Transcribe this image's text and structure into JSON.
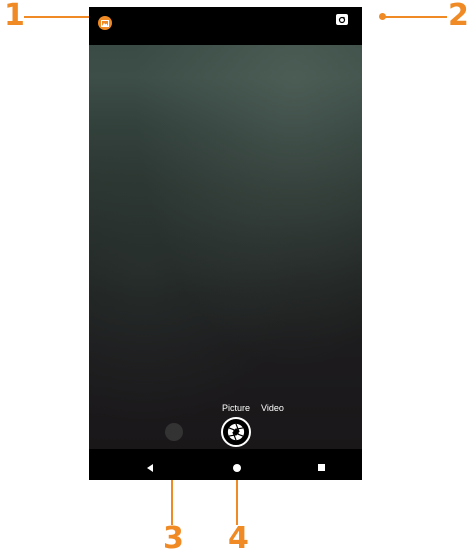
{
  "callouts": {
    "c1": "1",
    "c2": "2",
    "c3": "3",
    "c4": "4",
    "color": "#F08A24"
  },
  "camera": {
    "modes": {
      "picture": "Picture",
      "video": "Video"
    },
    "icons": {
      "gallery": "gallery-icon",
      "switch_camera": "switch-camera-icon",
      "shutter": "shutter-aperture-icon",
      "thumbnail": "last-photo-thumbnail"
    }
  },
  "navigation": {
    "icons": [
      "back-icon",
      "home-icon",
      "recents-icon"
    ]
  }
}
